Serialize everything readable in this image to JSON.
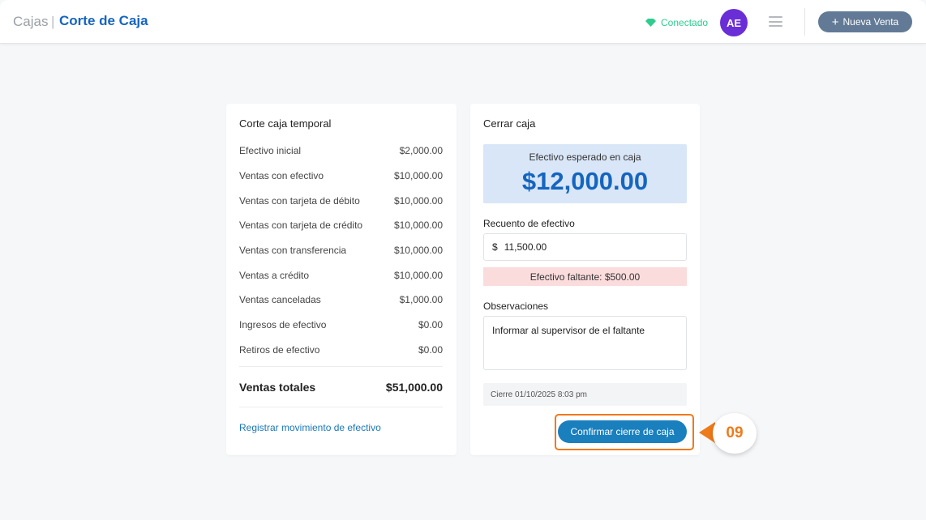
{
  "header": {
    "breadcrumb_parent": "Cajas",
    "breadcrumb_separator": "|",
    "page_title": "Corte de Caja",
    "status_label": "Conectado",
    "status_color": "#2ecc8f",
    "avatar_initials": "AE",
    "avatar_color": "#6a2ed6",
    "menu_icon": "hamburger-menu-icon",
    "new_sale_icon": "plus",
    "new_sale_label": "Nueva Venta"
  },
  "summary": {
    "title": "Corte caja temporal",
    "rows": [
      {
        "label": "Efectivo inicial",
        "value": "$2,000.00"
      },
      {
        "label": "Ventas con efectivo",
        "value": "$10,000.00"
      },
      {
        "label": "Ventas con tarjeta de débito",
        "value": "$10,000.00"
      },
      {
        "label": "Ventas con tarjeta de crédito",
        "value": "$10,000.00"
      },
      {
        "label": "Ventas con transferencia",
        "value": "$10,000.00"
      },
      {
        "label": "Ventas a crédito",
        "value": "$10,000.00"
      },
      {
        "label": "Ventas canceladas",
        "value": "$1,000.00"
      },
      {
        "label": "Ingresos de efectivo",
        "value": "$0.00"
      },
      {
        "label": "Retiros de efectivo",
        "value": "$0.00"
      }
    ],
    "total_label": "Ventas totales",
    "total_value": "$51,000.00",
    "register_link": "Registrar movimiento de efectivo"
  },
  "close": {
    "title": "Cerrar caja",
    "expected_label": "Efectivo esperado en caja",
    "expected_value": "$12,000.00",
    "count_label": "Recuento de efectivo",
    "currency_symbol": "$",
    "count_value": "11,500.00",
    "missing_text": "Efectivo faltante: $500.00",
    "notes_label": "Observaciones",
    "notes_value": "Informar al supervisor de el faltante",
    "close_date": "Cierre 01/10/2025 8:03 pm",
    "confirm_label": "Confirmar cierre de caja"
  },
  "annotation": {
    "step_number": "09",
    "color": "#ef7a1a"
  }
}
